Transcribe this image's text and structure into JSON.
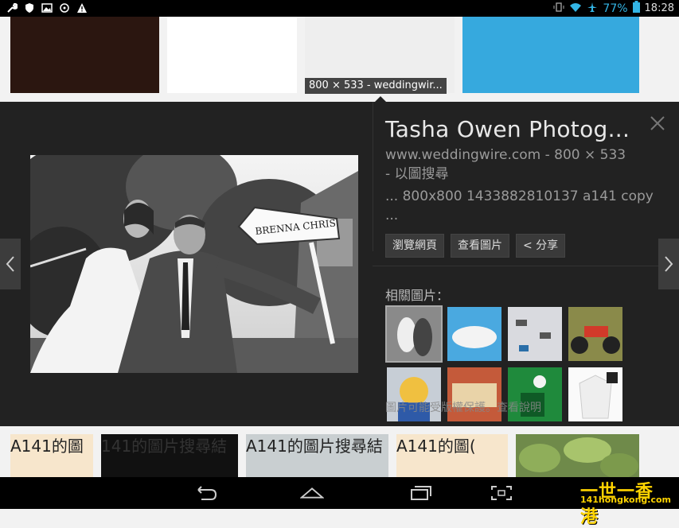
{
  "status_bar": {
    "battery_pct": "77%",
    "time": "18:28"
  },
  "tooltip": "800 × 533 - weddingwir...",
  "detail": {
    "title": "Tasha Owen Photog...",
    "source_line": "www.weddingwire.com - 800 × 533",
    "search_by_image": " - 以圖搜尋",
    "description": "... 800x800 1433882810137 a141 copy ...",
    "buttons": {
      "visit": "瀏覽網頁",
      "view_image": "查看圖片",
      "share": "< 分享"
    },
    "related_label": "相關圖片：",
    "copyright_notice": "圖片可能受版權保護。查看說明",
    "photo_sign_text": "BRENNA CHRIS"
  },
  "bottom_strip": {
    "items": [
      "A141的圖",
      "141的圖片搜尋結",
      "A141的圖片搜尋結",
      "A141的圖("
    ]
  },
  "watermark": {
    "chinese": "一世一香港",
    "url": "141hongkong.com"
  },
  "colors": {
    "accent": "#33b5e5",
    "panel_bg": "#222222"
  }
}
